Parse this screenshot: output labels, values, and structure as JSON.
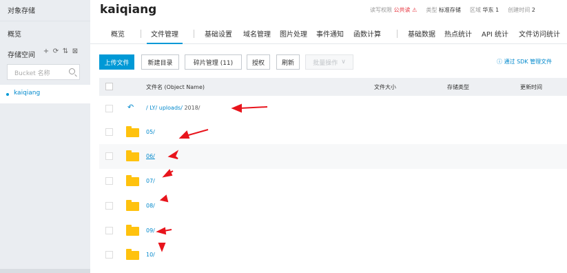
{
  "sidebar": {
    "title": "对象存储",
    "overview": "概览",
    "storage_space": "存储空间",
    "tools": [
      "+",
      "⟳",
      "⇅",
      "⊠"
    ],
    "search_placeholder": "Bucket 名称",
    "bucket": "kaiqiang"
  },
  "header": {
    "bucket_name": "kaiqiang",
    "rw_label": "读写权限",
    "rw_value": "公共读",
    "rw_warn_icon": "warning-icon",
    "type_label": "类型",
    "type_value": "标准存储",
    "region_label": "区域",
    "region_value": "华东 1",
    "created_label": "创建时间",
    "created_value": "2"
  },
  "tabs": [
    "概览",
    "文件管理",
    "基础设置",
    "域名管理",
    "图片处理",
    "事件通知",
    "函数计算",
    "基础数据",
    "热点统计",
    "API 统计",
    "文件访问统计"
  ],
  "active_tab": "文件管理",
  "toolbar": {
    "upload": "上传文件",
    "new_dir": "新建目录",
    "fragments": "碎片管理 (11)",
    "authorize": "授权",
    "refresh": "刷新",
    "batch": "批量操作",
    "sdk_link": "通过 SDK 管理文件"
  },
  "table": {
    "headers": [
      "文件名 (Object Name)",
      "文件大小",
      "存储类型",
      "更新时间"
    ],
    "path": {
      "segments": [
        "/",
        "LY/",
        "uploads/"
      ],
      "current": "2018/"
    },
    "folders": [
      "05/",
      "06/",
      "07/",
      "08/",
      "09/",
      "10/"
    ]
  },
  "colors": {
    "accent": "#0099d6",
    "link": "#0088cc",
    "warn": "#e6323c",
    "folder": "#ffc20e",
    "annotation": "#e8141c"
  }
}
